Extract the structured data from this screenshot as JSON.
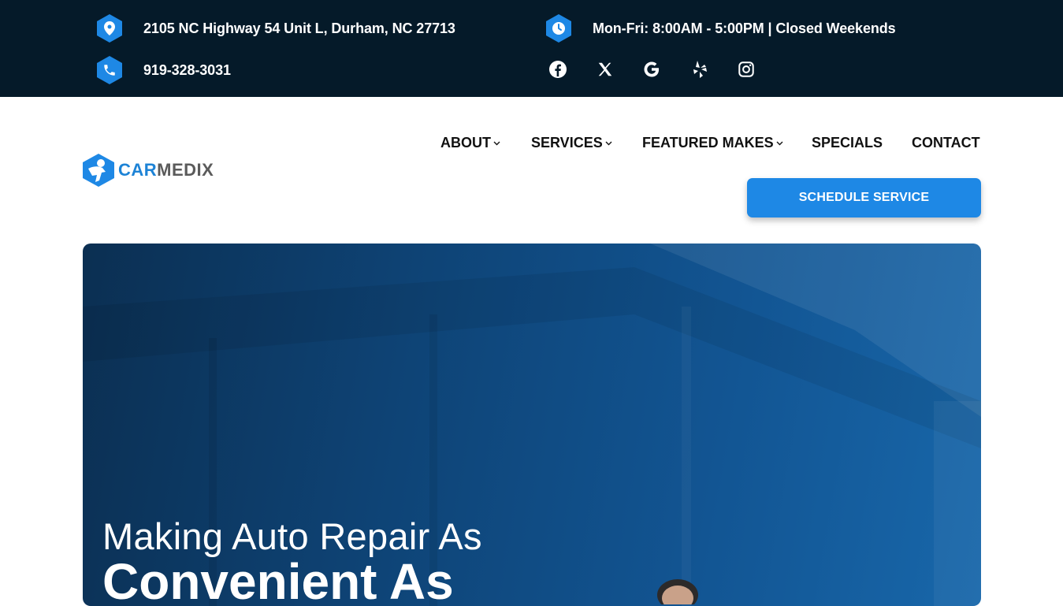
{
  "topbar": {
    "address": "2105 NC Highway 54 Unit L, Durham, NC 27713",
    "hours": "Mon-Fri: 8:00AM - 5:00PM | Closed Weekends",
    "phone": "919-328-3031",
    "icons": [
      "map-pin-icon",
      "clock-icon",
      "phone-icon"
    ],
    "social": [
      "facebook-icon",
      "x-twitter-icon",
      "google-icon",
      "yelp-icon",
      "instagram-icon"
    ]
  },
  "header": {
    "logo": {
      "part1": "CAR",
      "part2": "MEDIX"
    },
    "nav": [
      {
        "label": "ABOUT",
        "dropdown": true
      },
      {
        "label": "SERVICES",
        "dropdown": true
      },
      {
        "label": "FEATURED MAKES",
        "dropdown": true
      },
      {
        "label": "SPECIALS",
        "dropdown": false
      },
      {
        "label": "CONTACT",
        "dropdown": false
      }
    ],
    "cta": "SCHEDULE SERVICE"
  },
  "hero": {
    "line1": "Making Auto Repair As",
    "line2": "Convenient As"
  },
  "colors": {
    "topbar_bg": "#051a29",
    "accent": "#1e88e5",
    "hero_blue": "#125593"
  }
}
